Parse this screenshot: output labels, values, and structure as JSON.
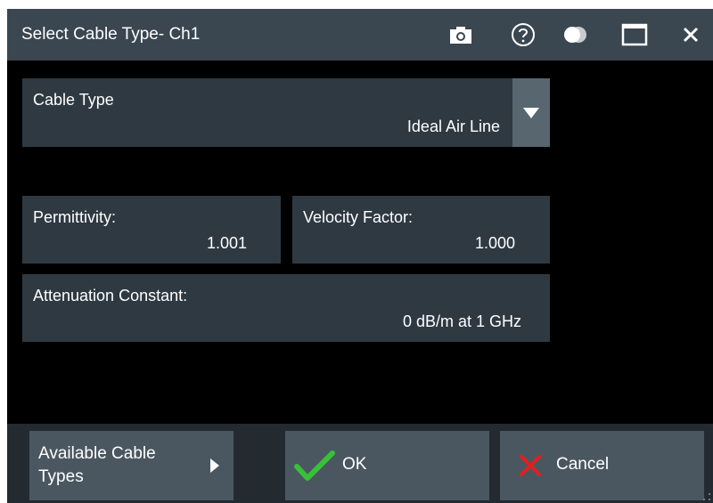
{
  "window": {
    "title": "Select Cable Type- Ch1",
    "icons": [
      "camera-icon",
      "help-icon",
      "transparency-icon",
      "maximize-icon",
      "close-icon"
    ]
  },
  "cable_type": {
    "label": "Cable Type",
    "value": "Ideal Air Line"
  },
  "permittivity": {
    "label": "Permittivity:",
    "value": "1.001"
  },
  "velocity_factor": {
    "label": "Velocity Factor:",
    "value": "1.000"
  },
  "attenuation": {
    "label": "Attenuation Constant:",
    "value": "0 dB/m at 1 GHz"
  },
  "buttons": {
    "available_line1": "Available Cable",
    "available_line2": "Types",
    "ok": "OK",
    "cancel": "Cancel"
  },
  "colors": {
    "titlebar": "#3a4650",
    "field": "#2f3942",
    "button": "#4a5760",
    "ok_check": "#38c038",
    "cancel_x": "#e02020"
  }
}
